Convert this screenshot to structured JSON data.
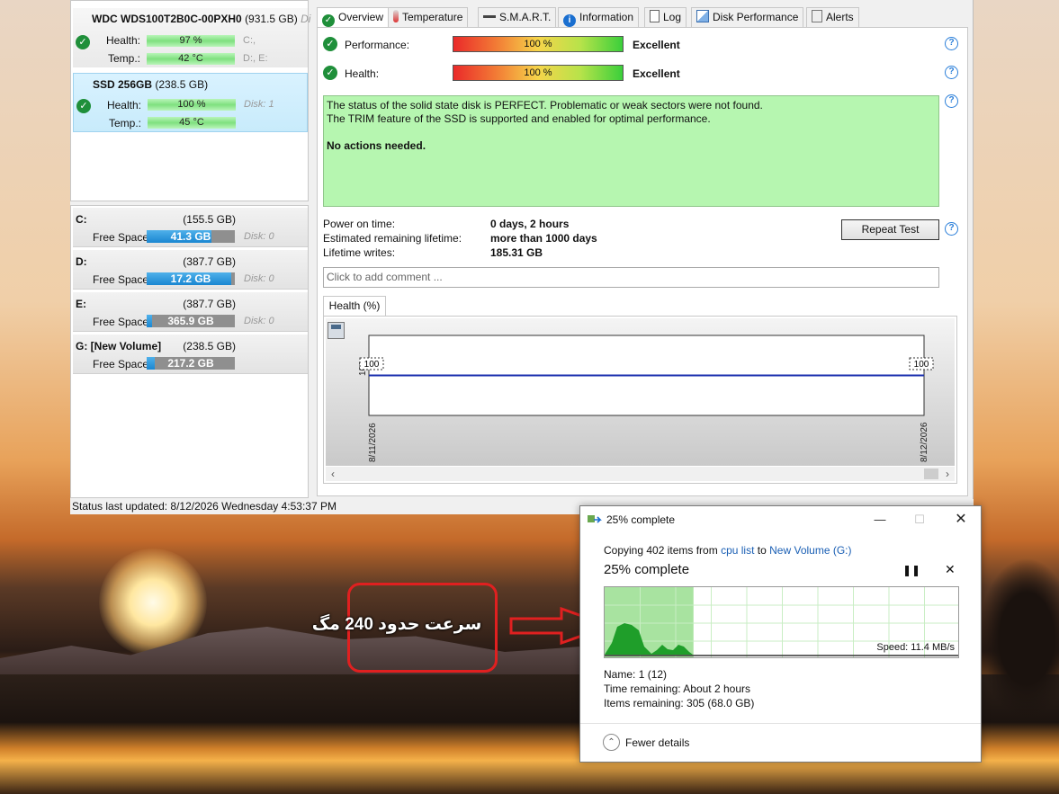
{
  "disks": [
    {
      "name": "WDC WDS100T2B0C-00PXH0",
      "size": "(931.5 GB)",
      "cut": "Di",
      "health_label": "Health:",
      "health": "97 %",
      "temp_label": "Temp.:",
      "temp": "42 °C",
      "note1": "C:,",
      "note2": "D:, E:"
    },
    {
      "name": "SSD 256GB",
      "size": "(238.5 GB)",
      "health_label": "Health:",
      "health": "100 %",
      "temp_label": "Temp.:",
      "temp": "45 °C",
      "note1": "Disk: 1"
    }
  ],
  "volumes": [
    {
      "name": "C:",
      "capacity": "(155.5 GB)",
      "free_label": "Free Space",
      "free": "41.3 GB",
      "disk": "Disk: 0",
      "fill": 0.73
    },
    {
      "name": "D:",
      "capacity": "(387.7 GB)",
      "free_label": "Free Space",
      "free": "17.2 GB",
      "disk": "Disk: 0",
      "fill": 0.96
    },
    {
      "name": "E:",
      "capacity": "(387.7 GB)",
      "free_label": "Free Space",
      "free": "365.9 GB",
      "disk": "Disk: 0",
      "fill": 0.06
    },
    {
      "name": "G: [New Volume]",
      "capacity": "(238.5 GB)",
      "free_label": "Free Space",
      "free": "217.2 GB",
      "fill": 0.09
    }
  ],
  "tabs": [
    "Overview",
    "Temperature",
    "S.M.A.R.T.",
    "Information",
    "Log",
    "Disk Performance",
    "Alerts"
  ],
  "overview": {
    "performance_label": "Performance:",
    "performance_value": "100 %",
    "performance_rating": "Excellent",
    "health_label": "Health:",
    "health_value": "100 %",
    "health_rating": "Excellent",
    "status_line1": "The status of the solid state disk is PERFECT. Problematic or weak sectors were not found.",
    "status_line2": "The TRIM feature of the SSD is supported and enabled for optimal performance.",
    "status_action": "No actions needed.",
    "power_on_label": "Power on time:",
    "power_on_value": "0 days, 2 hours",
    "lifetime_label": "Estimated remaining lifetime:",
    "lifetime_value": "more than 1000 days",
    "writes_label": "Lifetime writes:",
    "writes_value": "185.31 GB",
    "repeat_label": "Repeat Test",
    "comment_placeholder": "Click to add comment ...",
    "health_tab": "Health (%)",
    "help_glyph": "?"
  },
  "chart_data": {
    "type": "line",
    "x": [
      "8/11/2026",
      "8/12/2026"
    ],
    "series": [
      {
        "values": [
          100,
          100
        ]
      }
    ],
    "ytick": "100",
    "data_labels": [
      "100",
      "100"
    ]
  },
  "status_bar": "Status last updated: 8/12/2026 Wednesday 4:53:37 PM",
  "copy_dialog": {
    "title": "25% complete",
    "copying_prefix": "Copying 402 items from",
    "source": "cpu list",
    "to_word": "to",
    "dest": "New Volume (G:)",
    "heading": "25% complete",
    "progress": 0.25,
    "speed": "Speed: 11.4 MB/s",
    "name_label": "Name:",
    "name_value": "1 (12)",
    "time_label": "Time remaining:",
    "time_value": "About 2 hours",
    "items_label": "Items remaining:",
    "items_value": "305 (68.0 GB)",
    "fewer": "Fewer details"
  },
  "annotation": "سرعت حدود 240 مگ",
  "colors": {
    "accent": "#2b7fd9",
    "ok": "#1f8f3a",
    "status_bg": "#b6f6b0",
    "annot": "#e02020"
  }
}
